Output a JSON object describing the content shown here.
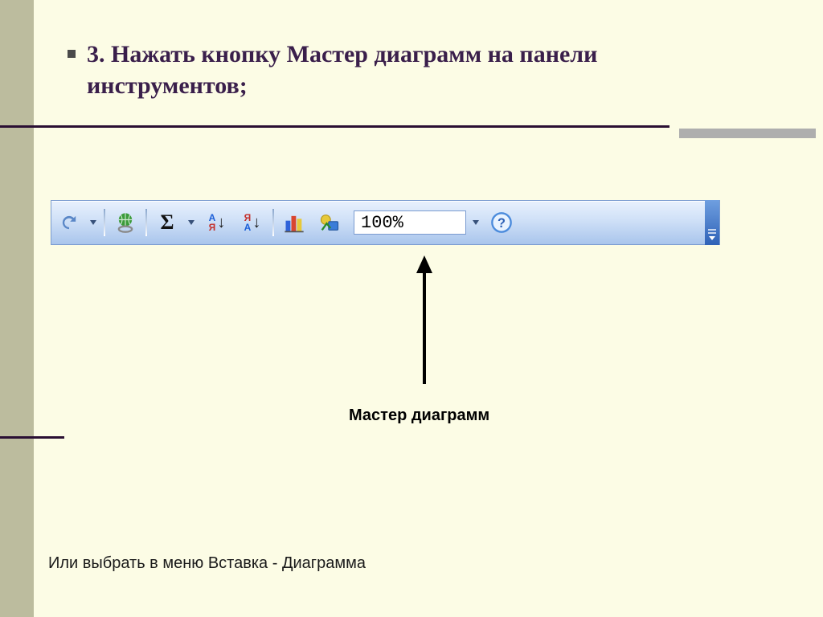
{
  "title": "3. Нажать кнопку Мастер диаграмм на панели инструментов;",
  "callout": "Мастер диаграмм",
  "footer": "Или выбрать в меню Вставка - Диаграмма",
  "toolbar": {
    "zoom_value": "100%",
    "icons": {
      "redo": "redo-icon",
      "hyperlink": "hyperlink-icon",
      "sum": "Σ",
      "sort_asc": "sort-asc-icon",
      "sort_desc": "sort-desc-icon",
      "chart_wizard": "chart-wizard-icon",
      "drawing": "drawing-icon",
      "help": "help-icon"
    }
  }
}
